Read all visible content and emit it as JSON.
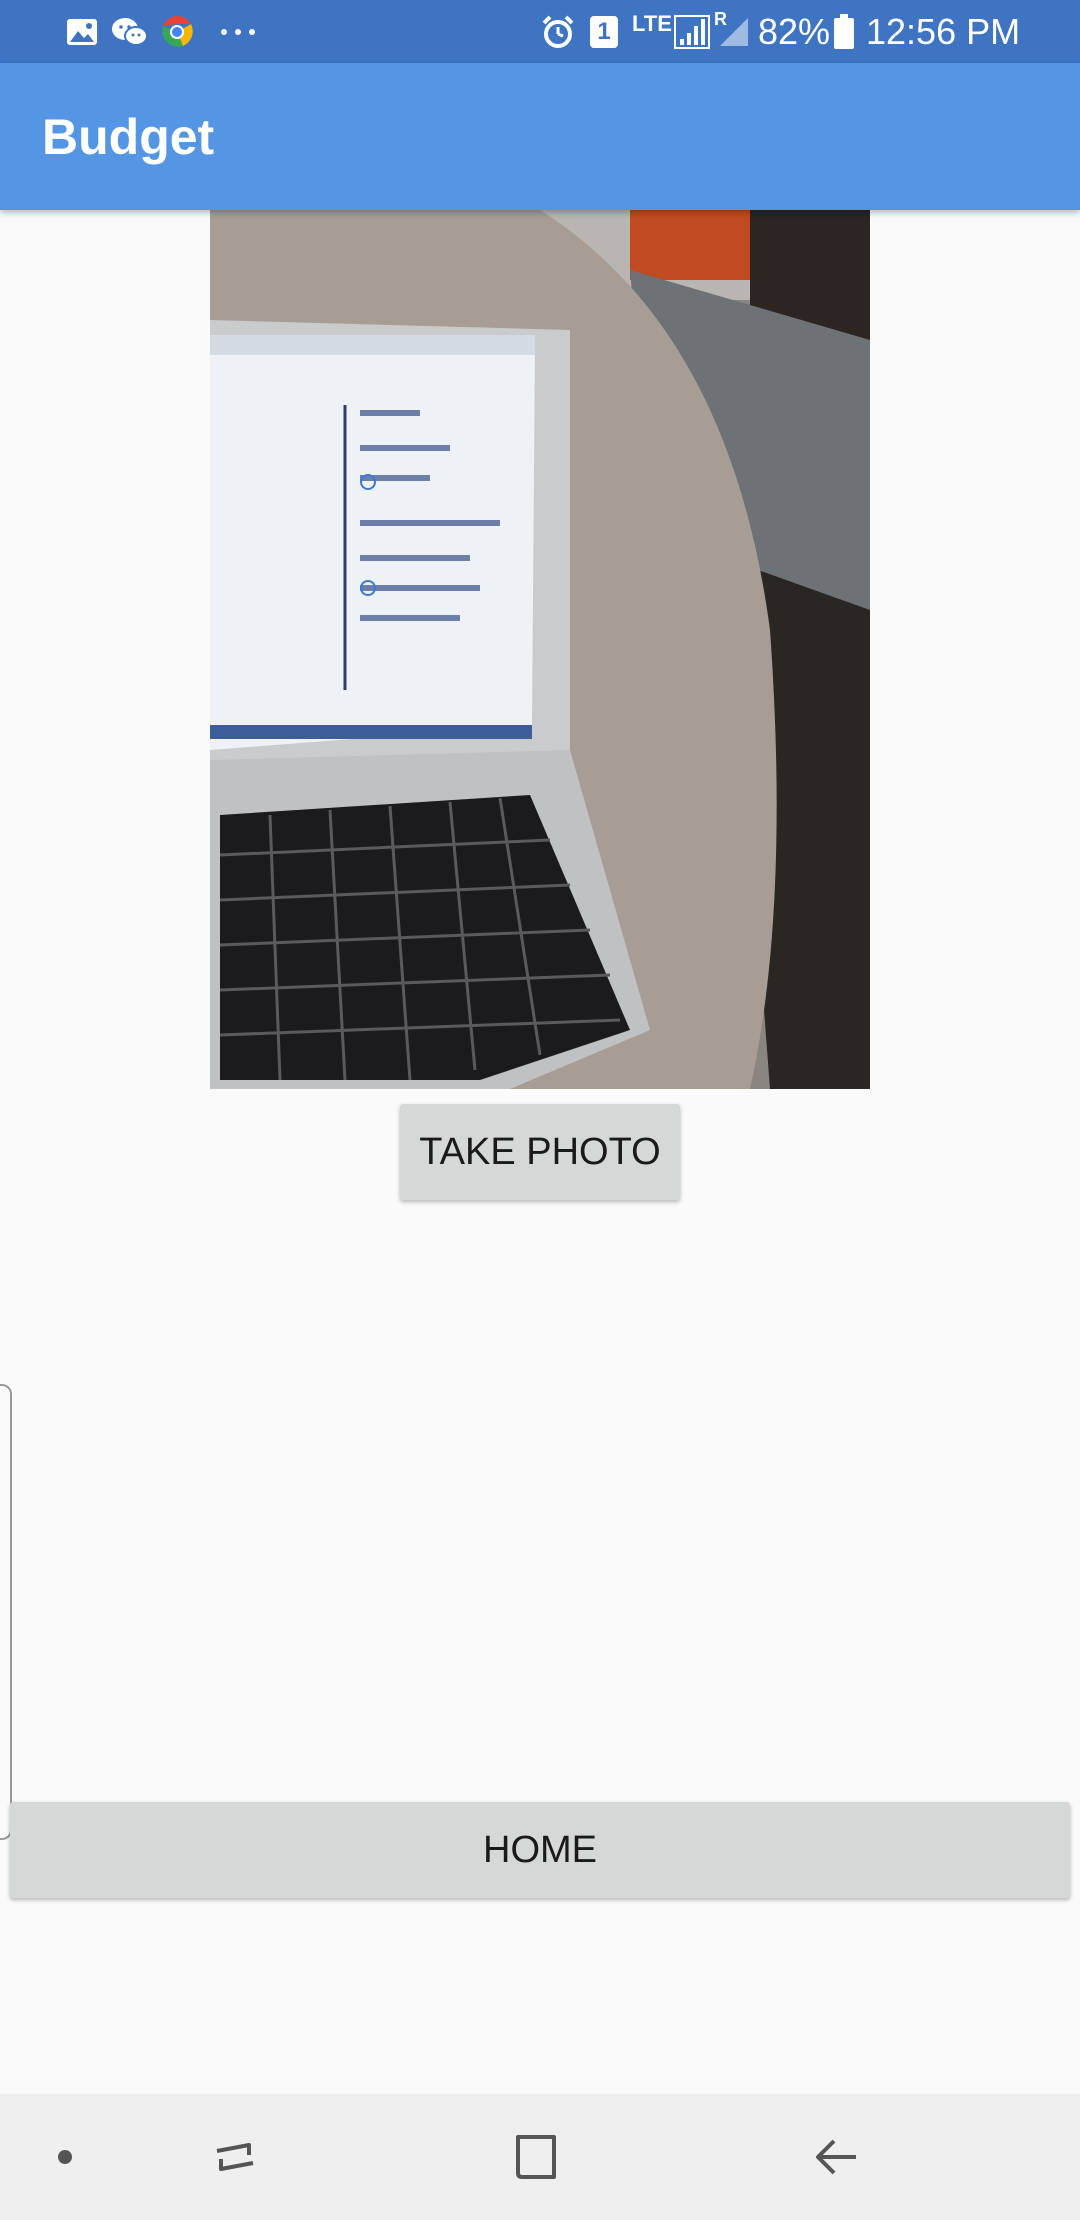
{
  "status_bar": {
    "icons_left": [
      "gallery-icon",
      "wechat-icon",
      "chrome-icon",
      "more-dots-icon"
    ],
    "icons_right": [
      "alarm-icon",
      "sim-1-icon",
      "lte-icon",
      "signal-icon",
      "roaming-signal-icon",
      "battery-icon"
    ],
    "sim_label": "1",
    "lte_label": "LTE",
    "roaming_label": "R",
    "battery_percent": "82%",
    "time": "12:56 PM"
  },
  "app_bar": {
    "title": "Budget"
  },
  "photo": {
    "icon": "captured-photo-laptop"
  },
  "buttons": {
    "take_photo": "TAKE PHOTO",
    "home": "HOME"
  },
  "nav_bar": {
    "icons": [
      "dot-icon",
      "recents-icon",
      "home-square-icon",
      "back-arrow-icon"
    ]
  },
  "colors": {
    "status_bar": "#3f74c3",
    "app_bar": "#5596e4",
    "button_bg": "#d6d7d7",
    "background": "#fafafa",
    "nav_bar": "#efefef"
  }
}
